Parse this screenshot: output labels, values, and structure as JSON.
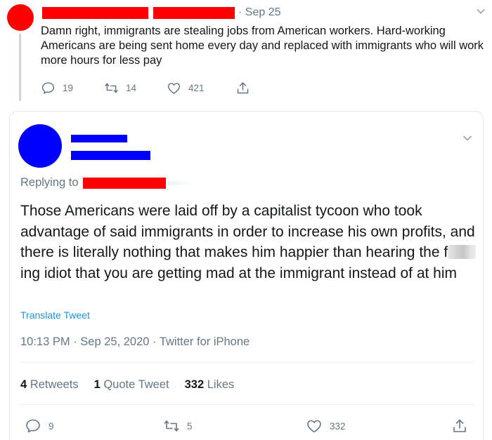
{
  "parent_tweet": {
    "date": "· Sep 25",
    "text": "Damn right, immigrants are stealing jobs from American workers. Hard-working Americans are being sent home every day and replaced with immigrants who will work more hours for less pay",
    "counts": {
      "replies": "19",
      "retweets": "14",
      "likes": "421"
    },
    "colors": {
      "avatar": "#ff0000",
      "redaction": "#ff0000"
    }
  },
  "focused_tweet": {
    "replying_label": "Replying to",
    "text_before": "Those Americans were laid off by a capitalist tycoon who took advantage of said immigrants in order to increase his own profits, and there is literally nothing that makes him happier than hearing the f",
    "text_after": "ing idiot that you are getting mad at the immigrant instead of at him",
    "translate_label": "Translate Tweet",
    "meta": "10:13 PM · Sep 25, 2020 · Twitter for iPhone",
    "stats": {
      "retweets_count": "4",
      "retweets_label": "Retweets",
      "quotes_count": "1",
      "quotes_label": "Quote Tweet",
      "likes_count": "332",
      "likes_label": "Likes"
    },
    "counts": {
      "replies": "9",
      "retweets": "5",
      "likes": "332"
    },
    "colors": {
      "avatar": "#0000ff",
      "redaction_name": "#0000ff",
      "redaction_reply_to": "#ff0000",
      "link": "#1b95e0"
    }
  },
  "icons": [
    "reply-icon",
    "retweet-icon",
    "like-icon",
    "share-icon",
    "chevron-down-icon"
  ]
}
